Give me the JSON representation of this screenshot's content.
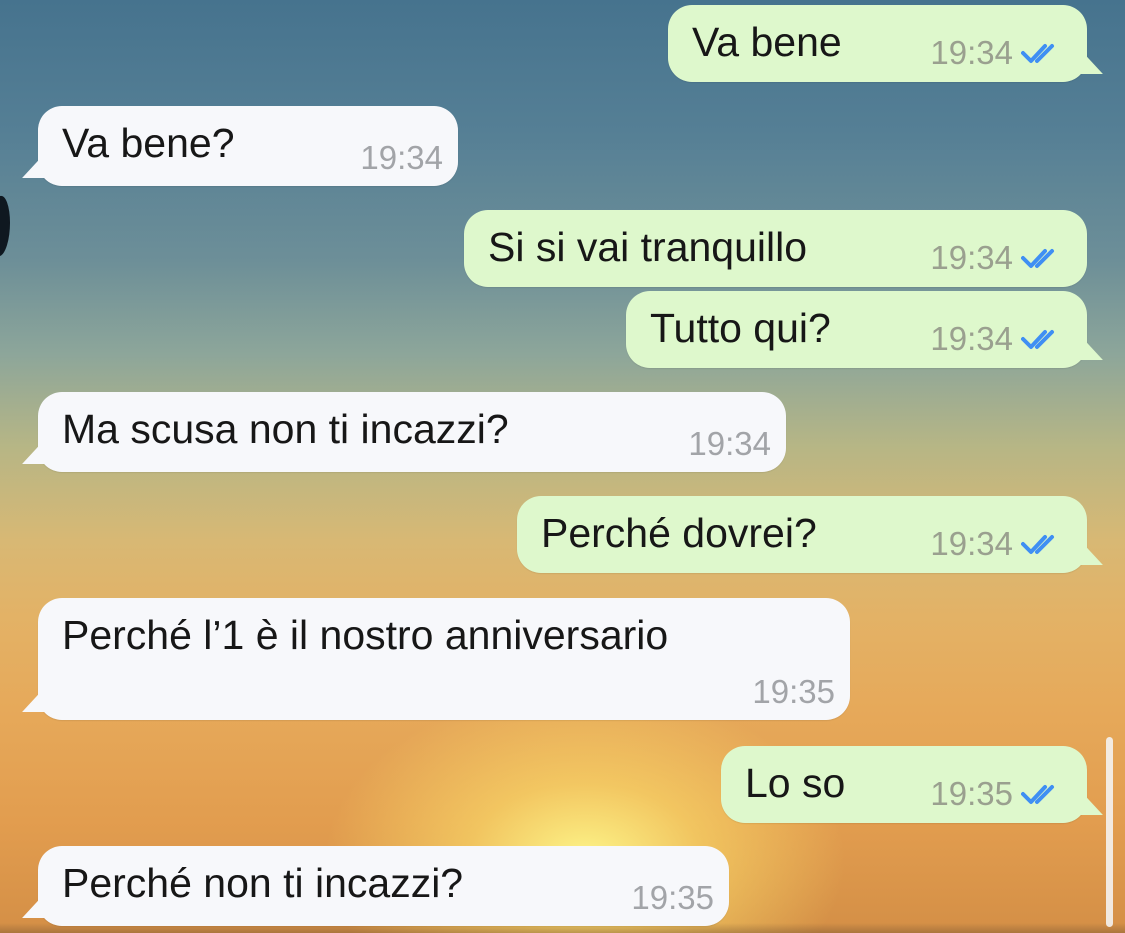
{
  "chat": {
    "messages": [
      {
        "direction": "out",
        "text": "Va bene",
        "time": "19:34",
        "status": "read"
      },
      {
        "direction": "in",
        "text": "Va bene?",
        "time": "19:34"
      },
      {
        "direction": "out",
        "text": "Si si vai tranquillo",
        "time": "19:34",
        "status": "read"
      },
      {
        "direction": "out",
        "text": "Tutto qui?",
        "time": "19:34",
        "status": "read"
      },
      {
        "direction": "in",
        "text": "Ma scusa non ti incazzi?",
        "time": "19:34"
      },
      {
        "direction": "out",
        "text": "Perché dovrei?",
        "time": "19:34",
        "status": "read"
      },
      {
        "direction": "in",
        "text": "Perché l’1 è il nostro anniversario",
        "time": "19:35"
      },
      {
        "direction": "out",
        "text": "Lo so",
        "time": "19:35",
        "status": "read"
      },
      {
        "direction": "in",
        "text": "Perché non ti incazzi?",
        "time": "19:35"
      }
    ]
  },
  "colors": {
    "outgoing_bubble": "#def8cc",
    "incoming_bubble": "#f7f8fb",
    "read_ticks": "#3f8ff3",
    "timestamp": "#9aa08f"
  },
  "icons": {
    "read_receipt": "double-check-icon"
  }
}
